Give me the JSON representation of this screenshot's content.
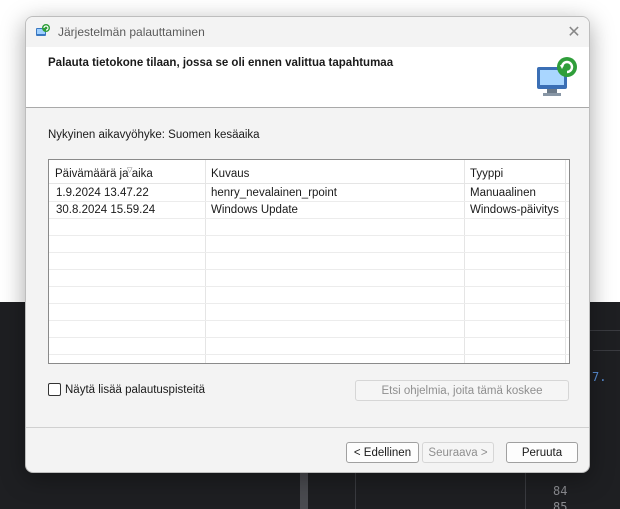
{
  "background": {
    "code_partial": "7.",
    "line_numbers": [
      "84",
      "85"
    ]
  },
  "dialog": {
    "title": "Järjestelmän palauttaminen",
    "header_title": "Palauta tietokone tilaan, jossa se oli ennen valittua tapahtumaa",
    "timezone_label": "Nykyinen aikavyöhyke: Suomen kesäaika",
    "table": {
      "columns": [
        "Päivämäärä ja aika",
        "Kuvaus",
        "Tyyppi"
      ],
      "rows": [
        {
          "date": "1.9.2024 13.47.22",
          "description": "henry_nevalainen_rpoint",
          "type": "Manuaalinen"
        },
        {
          "date": "30.8.2024 15.59.24",
          "description": "Windows Update",
          "type": "Windows-päivitys"
        }
      ]
    },
    "show_more_label": "Näytä lisää palautuspisteitä",
    "scan_button": "Etsi ohjelmia, joita tämä koskee",
    "prev_button": "< Edellinen",
    "next_button": "Seuraava >",
    "cancel_button": "Peruuta"
  },
  "icons": {
    "app": "system-restore-icon",
    "close": "close-icon",
    "header": "restore-computer-icon",
    "sort": "sort-down-icon"
  }
}
